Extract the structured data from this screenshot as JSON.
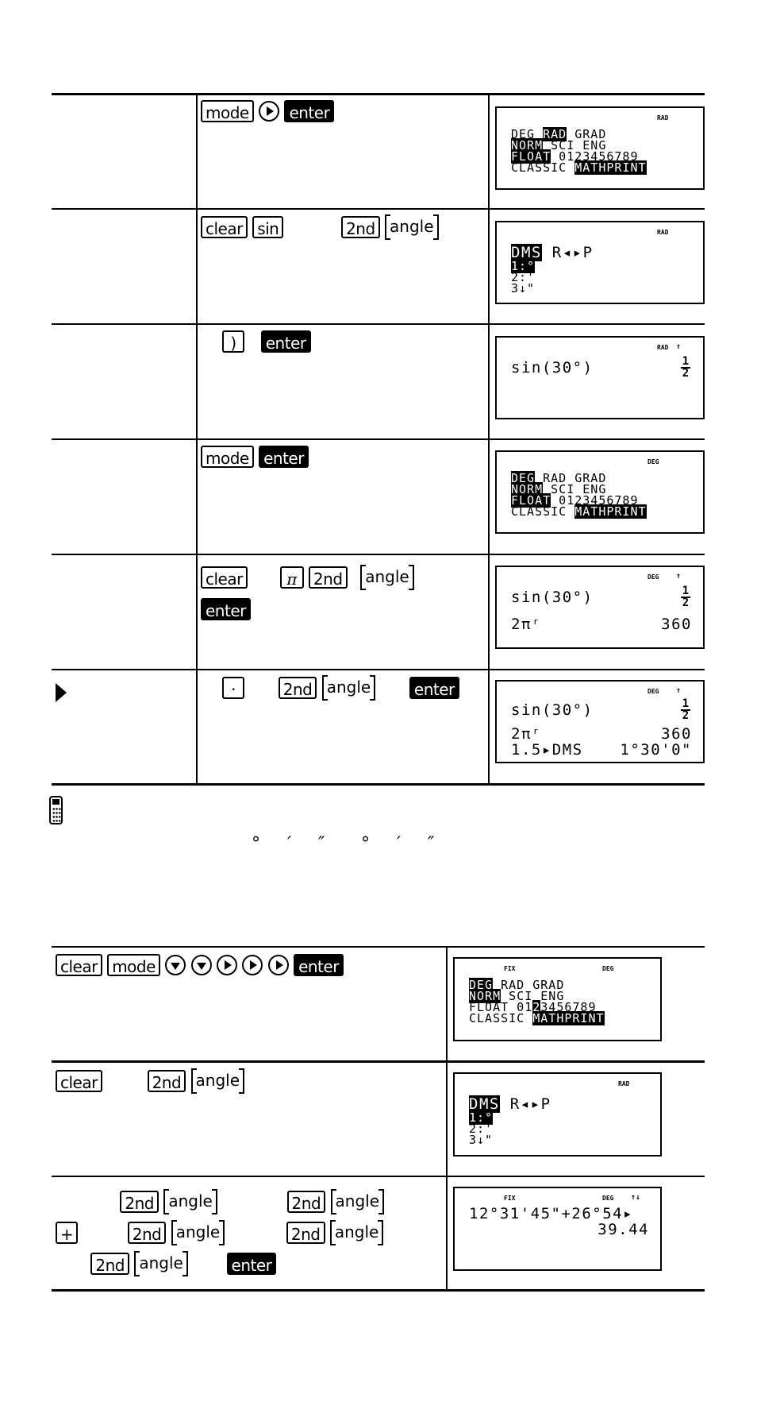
{
  "table1": {
    "rows": [
      {
        "step_label": "",
        "keys": {
          "k1": "mode",
          "k2": "right-arrow",
          "k3": "enter"
        },
        "screen": {
          "indicators": [
            "RAD"
          ],
          "lines": [
            "DEG",
            "RAD",
            "GRAD",
            "NORM",
            "SCI ENG",
            "FLOAT",
            "0123456789",
            "CLASSIC",
            "MATHPRINT"
          ],
          "highlighted": [
            "RAD",
            "NORM",
            "FLOAT",
            "MATHPRINT"
          ]
        }
      },
      {
        "step_label": "",
        "keys": {
          "k1": "clear",
          "k2": "sin",
          "k3": "2nd",
          "k4": "angle"
        },
        "screen": {
          "indicators": [
            "RAD"
          ],
          "menu_tabs": [
            "DMS",
            "R◂▸P"
          ],
          "menu_items": [
            "1:°",
            "2:'",
            "3↓\""
          ]
        }
      },
      {
        "step_label": "",
        "keys": {
          "k1": ")",
          "k2": "enter"
        },
        "screen": {
          "indicators": [
            "RAD",
            "↑"
          ],
          "expr": "sin(30°)",
          "result_num": "1",
          "result_den": "2"
        }
      },
      {
        "step_label": "",
        "keys": {
          "k1": "mode",
          "k2": "enter"
        },
        "screen": {
          "indicators": [
            "DEG"
          ],
          "highlighted": [
            "DEG",
            "NORM",
            "FLOAT",
            "MATHPRINT"
          ]
        }
      },
      {
        "step_label": "",
        "keys": {
          "k1": "clear",
          "k2": "π",
          "k3": "2nd",
          "k4": "angle",
          "k5": "enter"
        },
        "screen": {
          "indicators": [
            "DEG",
            "↑"
          ],
          "expr1": "sin(30°)",
          "result1_num": "1",
          "result1_den": "2",
          "expr2": "2πʳ",
          "result2": "360"
        }
      },
      {
        "step_label": "▶",
        "keys": {
          "k1": "·",
          "k2": "2nd",
          "k3": "angle",
          "k4": "enter"
        },
        "screen": {
          "indicators": [
            "DEG",
            "↑"
          ],
          "expr1": "sin(30°)",
          "result1_num": "1",
          "result1_den": "2",
          "expr2": "2πʳ",
          "result2": "360",
          "expr3": "1.5▸DMS",
          "result3": "1°30'0\""
        }
      }
    ]
  },
  "note": {
    "icon": "calculator-icon",
    "symbols_a": [
      "°",
      "′",
      "″"
    ],
    "symbols_b": [
      "°",
      "′",
      "″"
    ]
  },
  "table2": {
    "rows": [
      {
        "keys": {
          "k1": "clear",
          "k2": "mode",
          "k3": "down-arrow",
          "k4": "down-arrow",
          "k5": "right-arrow",
          "k6": "right-arrow",
          "k7": "right-arrow",
          "k8": "enter"
        },
        "screen": {
          "indicators": [
            "FIX",
            "DEG"
          ],
          "line1": [
            "DEG",
            "RAD GRAD"
          ],
          "line2": [
            "NORM",
            "SCI ENG"
          ],
          "line3": [
            "FLOAT 01",
            "2",
            "3456789"
          ],
          "line4": [
            "CLASSIC",
            "MATHPRINT"
          ]
        }
      },
      {
        "keys": {
          "k1": "clear",
          "k2": "2nd",
          "k3": "angle"
        },
        "screen": {
          "indicators": [
            "RAD"
          ],
          "menu_tabs": [
            "DMS",
            "R◂▸P"
          ],
          "menu_items": [
            "1:°",
            "2:'",
            "3↓\""
          ]
        }
      },
      {
        "keys": {
          "r1": [
            "2nd",
            "angle",
            "2nd",
            "angle"
          ],
          "r2": [
            "+",
            "2nd",
            "angle",
            "2nd",
            "angle"
          ],
          "r3": [
            "2nd",
            "angle",
            "enter"
          ]
        },
        "screen": {
          "indicators": [
            "FIX",
            "DEG",
            "↑↓"
          ],
          "expr": "12°31'45\"+26°54▸",
          "result": "39.44"
        }
      }
    ]
  }
}
